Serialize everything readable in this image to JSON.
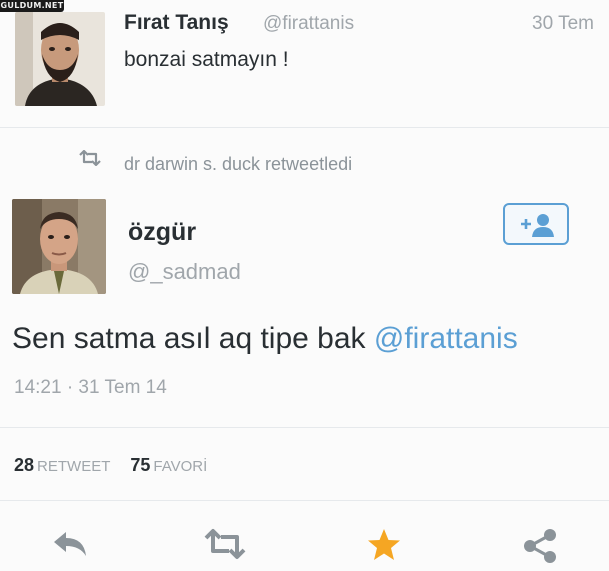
{
  "watermark": "GULDUM.NET",
  "quoted_tweet": {
    "name": "Fırat Tanış",
    "handle": "@firattanis",
    "time": "30 Tem",
    "text": "bonzai satmayın !"
  },
  "retweet_context": {
    "text": "dr darwin s. duck retweetledi",
    "icon": "retweet-icon"
  },
  "main_tweet": {
    "name": "özgür",
    "handle": "@_sadmad",
    "text_prefix": "Sen satma asıl aq tipe bak ",
    "mention": "@firattanis",
    "timestamp": "14:21 · 31 Tem 14",
    "follow_icon": "add-user-icon"
  },
  "stats": {
    "retweets_count": "28",
    "retweets_label": "RETWEET",
    "favorites_count": "75",
    "favorites_label": "FAVORİ"
  },
  "actions": [
    {
      "name": "reply",
      "icon": "reply-icon"
    },
    {
      "name": "retweet",
      "icon": "retweet-icon"
    },
    {
      "name": "favorite",
      "icon": "star-icon"
    },
    {
      "name": "share",
      "icon": "share-icon"
    }
  ],
  "colors": {
    "link": "#5b9fd4",
    "favorite": "#f5a623",
    "muted": "#a0a6ab",
    "text": "#292f33"
  }
}
